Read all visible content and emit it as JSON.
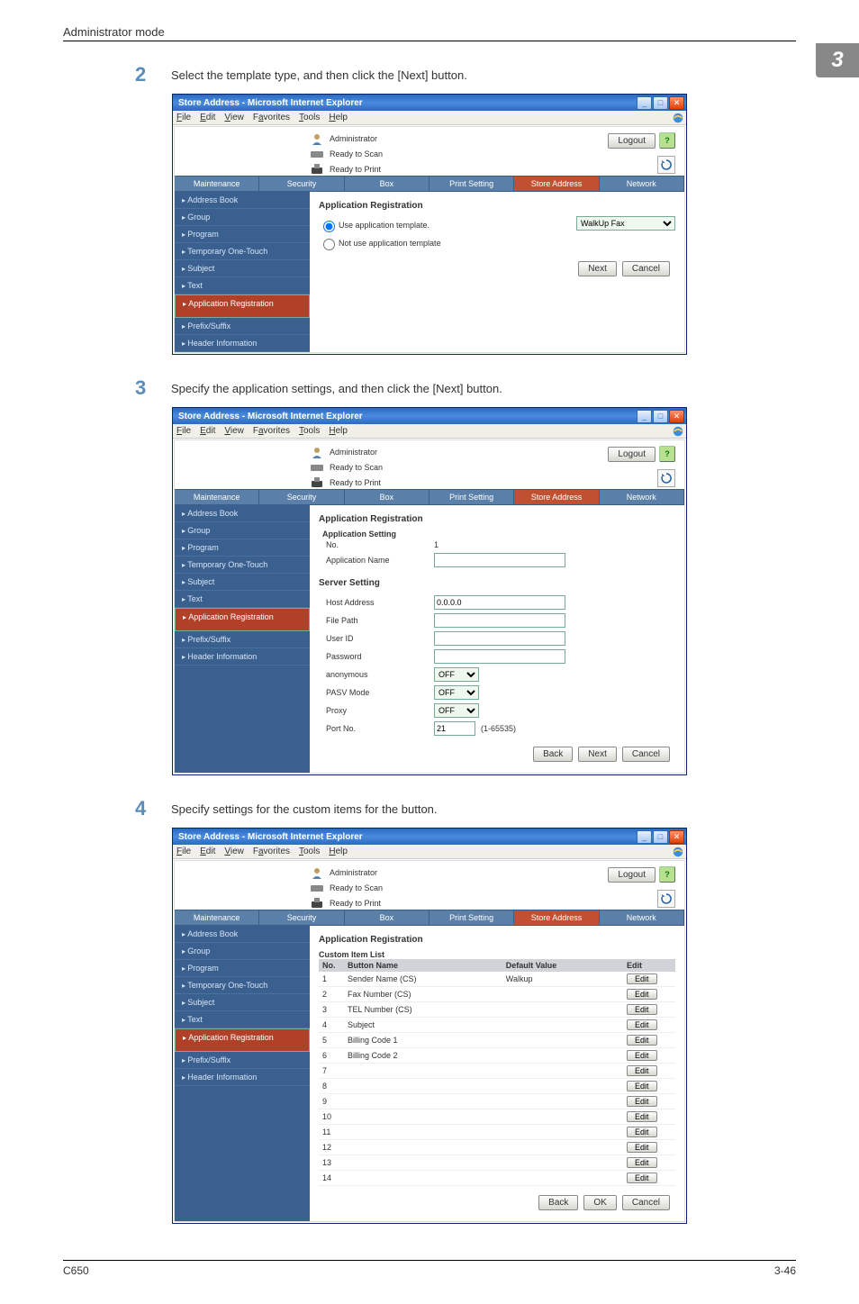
{
  "page_header": "Administrator mode",
  "chapter_badge": "3",
  "footer_left": "C650",
  "footer_right": "3-46",
  "steps": {
    "s2": {
      "num": "2",
      "text": "Select the template type, and then click the [Next] button."
    },
    "s3": {
      "num": "3",
      "text": "Specify the application settings, and then click the [Next] button."
    },
    "s4": {
      "num": "4",
      "text": "Specify settings for the custom items for the button."
    }
  },
  "browser_title": "Store Address - Microsoft Internet Explorer",
  "menus": {
    "file": "File",
    "edit": "Edit",
    "view": "View",
    "favorites": "Favorites",
    "tools": "Tools",
    "help": "Help"
  },
  "header": {
    "admin": "Administrator",
    "ready_scan": "Ready to Scan",
    "ready_print": "Ready to Print",
    "logout": "Logout"
  },
  "tabs": {
    "maintenance": "Maintenance",
    "security": "Security",
    "box": "Box",
    "print": "Print Setting",
    "store": "Store Address",
    "network": "Network"
  },
  "sidebar": {
    "items": [
      "Address Book",
      "Group",
      "Program",
      "Temporary One-Touch",
      "Subject",
      "Text",
      "Application Registration",
      "Prefix/Suffix",
      "Header Information"
    ]
  },
  "shot1": {
    "title": "Application Registration",
    "opt_use": "Use application template.",
    "opt_notuse": "Not use application template",
    "select_value": "WalkUp Fax",
    "btn_next": "Next",
    "btn_cancel": "Cancel"
  },
  "shot2": {
    "title": "Application Registration",
    "sect_app": "Application Setting",
    "lbl_no": "No.",
    "val_no": "1",
    "lbl_appname": "Application Name",
    "sect_server": "Server Setting",
    "lbl_host": "Host Address",
    "val_host": "0.0.0.0",
    "lbl_filepath": "File Path",
    "lbl_userid": "User ID",
    "lbl_password": "Password",
    "lbl_anon": "anonymous",
    "val_anon": "OFF",
    "lbl_pasv": "PASV Mode",
    "val_pasv": "OFF",
    "lbl_proxy": "Proxy",
    "val_proxy": "OFF",
    "lbl_port": "Port No.",
    "val_port": "21",
    "port_range": "(1-65535)",
    "btn_back": "Back",
    "btn_next": "Next",
    "btn_cancel": "Cancel"
  },
  "shot3": {
    "title": "Application Registration",
    "subtitle": "Custom Item List",
    "col_no": "No.",
    "col_btn": "Button Name",
    "col_def": "Default Value",
    "col_edit": "Edit",
    "rows": [
      {
        "no": "1",
        "name": "Sender Name (CS)",
        "def": "Walkup"
      },
      {
        "no": "2",
        "name": "Fax Number (CS)",
        "def": ""
      },
      {
        "no": "3",
        "name": "TEL Number (CS)",
        "def": ""
      },
      {
        "no": "4",
        "name": "Subject",
        "def": ""
      },
      {
        "no": "5",
        "name": "Billing Code 1",
        "def": ""
      },
      {
        "no": "6",
        "name": "Billing Code 2",
        "def": ""
      },
      {
        "no": "7",
        "name": "",
        "def": ""
      },
      {
        "no": "8",
        "name": "",
        "def": ""
      },
      {
        "no": "9",
        "name": "",
        "def": ""
      },
      {
        "no": "10",
        "name": "",
        "def": ""
      },
      {
        "no": "11",
        "name": "",
        "def": ""
      },
      {
        "no": "12",
        "name": "",
        "def": ""
      },
      {
        "no": "13",
        "name": "",
        "def": ""
      },
      {
        "no": "14",
        "name": "",
        "def": ""
      }
    ],
    "edit_label": "Edit",
    "btn_back": "Back",
    "btn_ok": "OK",
    "btn_cancel": "Cancel"
  }
}
